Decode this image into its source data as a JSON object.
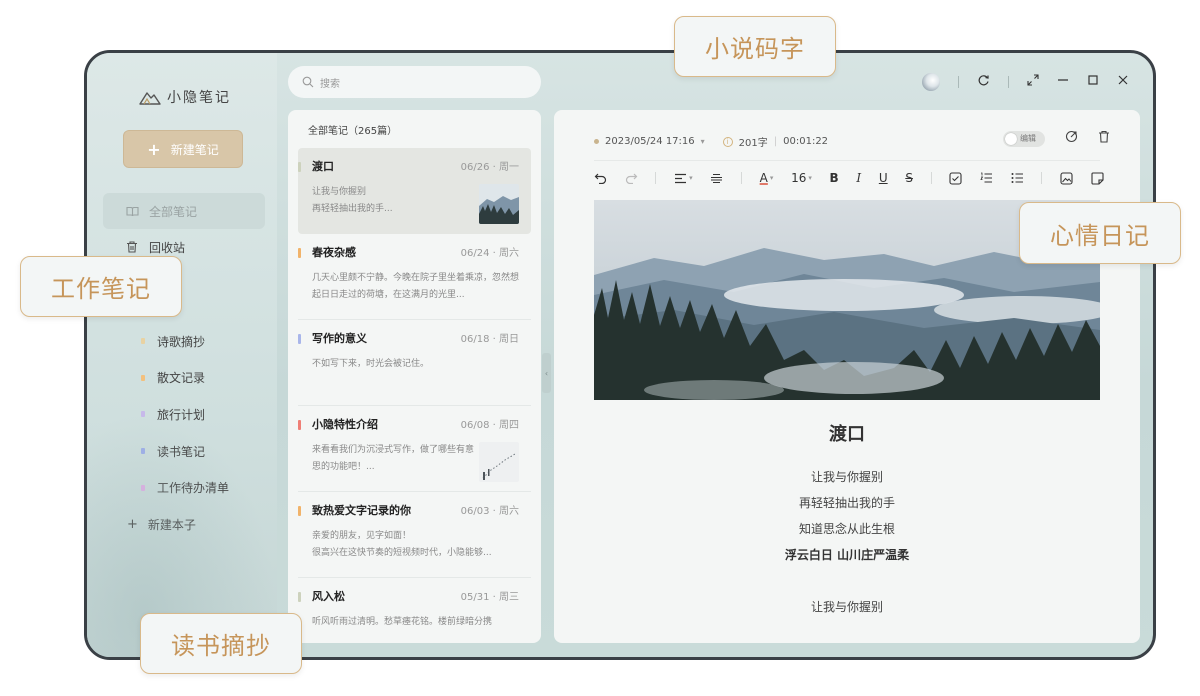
{
  "app": {
    "brand": "小隐笔记"
  },
  "sidebar": {
    "new_note": "新建笔记",
    "nav": [
      {
        "label": "全部笔记",
        "icon": "book-icon"
      },
      {
        "label": "回收站",
        "icon": "trash-icon"
      }
    ],
    "notebooks": [
      {
        "label": "诗歌摘抄",
        "color": "#e9d2a2"
      },
      {
        "label": "散文记录",
        "color": "#f3c07d"
      },
      {
        "label": "旅行计划",
        "color": "#c7b9ea"
      },
      {
        "label": "读书笔记",
        "color": "#9eaee9"
      },
      {
        "label": "工作待办清单",
        "color": "#e0aee5"
      }
    ],
    "add_notebook": "新建本子"
  },
  "search": {
    "placeholder": "搜索"
  },
  "list": {
    "header": "全部笔记（265篇）",
    "notes": [
      {
        "title": "渡口",
        "date": "06/26 · 周一",
        "excerpt": "让我与你握别\n再轻轻抽出我的手...",
        "bar": "#cdd2bd",
        "thumb": "mountains"
      },
      {
        "title": "春夜杂感",
        "date": "06/24 · 周六",
        "excerpt": "几天心里颇不宁静。今晚在院子里坐着乘凉，忽然想起日日走过的荷塘，在这满月的光里...",
        "bar": "#f1b36a",
        "thumb": ""
      },
      {
        "title": "写作的意义",
        "date": "06/18 · 周日",
        "excerpt": "不如写下来，时光会被记住。",
        "bar": "#a9b6ea",
        "thumb": ""
      },
      {
        "title": "小隐特性介绍",
        "date": "06/08 · 周四",
        "excerpt": "来看看我们为沉浸式写作，做了哪些有意思的功能吧！...",
        "bar": "#ef7f76",
        "thumb": "snow"
      },
      {
        "title": "致热爱文字记录的你",
        "date": "06/03 · 周六",
        "excerpt": "亲爱的朋友，见字如面！\n很高兴在这快节奏的短视频时代，小隐能够...",
        "bar": "#f1b36a",
        "thumb": ""
      },
      {
        "title": "风入松",
        "date": "05/31 · 周三",
        "excerpt": "听风听雨过清明。愁草瘗花铭。楼前绿暗分携",
        "bar": "#cdd2bd",
        "thumb": ""
      }
    ]
  },
  "editor": {
    "datetime": "2023/05/24 17:16",
    "word_count": "201字",
    "duration": "00:01:22",
    "toggle_label": "编辑",
    "font_size": "16",
    "doc": {
      "title": "渡口",
      "lines": [
        "让我与你握别",
        "再轻轻抽出我的手",
        "知道思念从此生根"
      ],
      "bold_line": "浮云白日 山川庄严温柔",
      "after": "让我与你握别"
    }
  },
  "callouts": {
    "typing": "小说码字",
    "mood": "心情日记",
    "work": "工作笔记",
    "reading": "读书摘抄"
  }
}
